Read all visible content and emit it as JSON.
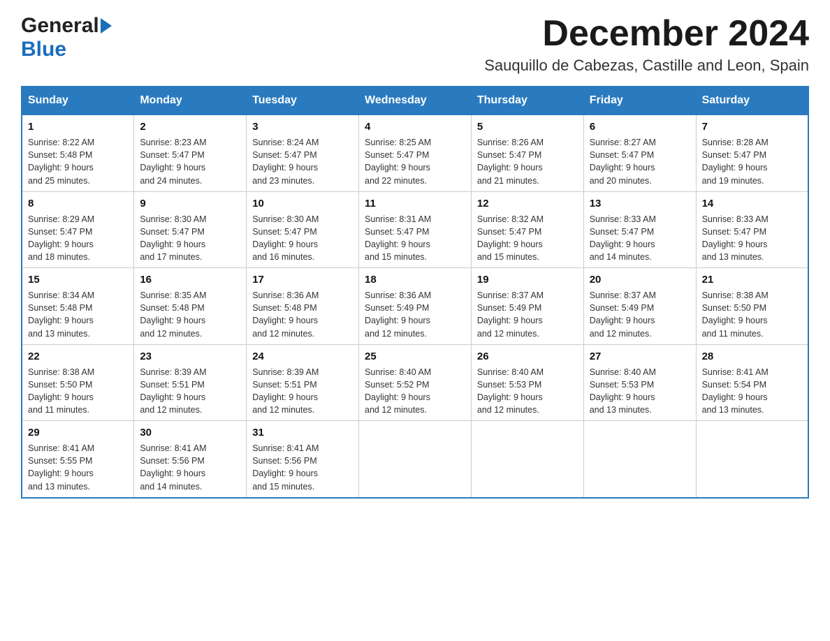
{
  "header": {
    "logo_general": "General",
    "logo_blue": "Blue",
    "month_title": "December 2024",
    "subtitle": "Sauquillo de Cabezas, Castille and Leon, Spain"
  },
  "days_of_week": [
    "Sunday",
    "Monday",
    "Tuesday",
    "Wednesday",
    "Thursday",
    "Friday",
    "Saturday"
  ],
  "weeks": [
    [
      {
        "day": "1",
        "sunrise": "8:22 AM",
        "sunset": "5:48 PM",
        "daylight": "9 hours and 25 minutes."
      },
      {
        "day": "2",
        "sunrise": "8:23 AM",
        "sunset": "5:47 PM",
        "daylight": "9 hours and 24 minutes."
      },
      {
        "day": "3",
        "sunrise": "8:24 AM",
        "sunset": "5:47 PM",
        "daylight": "9 hours and 23 minutes."
      },
      {
        "day": "4",
        "sunrise": "8:25 AM",
        "sunset": "5:47 PM",
        "daylight": "9 hours and 22 minutes."
      },
      {
        "day": "5",
        "sunrise": "8:26 AM",
        "sunset": "5:47 PM",
        "daylight": "9 hours and 21 minutes."
      },
      {
        "day": "6",
        "sunrise": "8:27 AM",
        "sunset": "5:47 PM",
        "daylight": "9 hours and 20 minutes."
      },
      {
        "day": "7",
        "sunrise": "8:28 AM",
        "sunset": "5:47 PM",
        "daylight": "9 hours and 19 minutes."
      }
    ],
    [
      {
        "day": "8",
        "sunrise": "8:29 AM",
        "sunset": "5:47 PM",
        "daylight": "9 hours and 18 minutes."
      },
      {
        "day": "9",
        "sunrise": "8:30 AM",
        "sunset": "5:47 PM",
        "daylight": "9 hours and 17 minutes."
      },
      {
        "day": "10",
        "sunrise": "8:30 AM",
        "sunset": "5:47 PM",
        "daylight": "9 hours and 16 minutes."
      },
      {
        "day": "11",
        "sunrise": "8:31 AM",
        "sunset": "5:47 PM",
        "daylight": "9 hours and 15 minutes."
      },
      {
        "day": "12",
        "sunrise": "8:32 AM",
        "sunset": "5:47 PM",
        "daylight": "9 hours and 15 minutes."
      },
      {
        "day": "13",
        "sunrise": "8:33 AM",
        "sunset": "5:47 PM",
        "daylight": "9 hours and 14 minutes."
      },
      {
        "day": "14",
        "sunrise": "8:33 AM",
        "sunset": "5:47 PM",
        "daylight": "9 hours and 13 minutes."
      }
    ],
    [
      {
        "day": "15",
        "sunrise": "8:34 AM",
        "sunset": "5:48 PM",
        "daylight": "9 hours and 13 minutes."
      },
      {
        "day": "16",
        "sunrise": "8:35 AM",
        "sunset": "5:48 PM",
        "daylight": "9 hours and 12 minutes."
      },
      {
        "day": "17",
        "sunrise": "8:36 AM",
        "sunset": "5:48 PM",
        "daylight": "9 hours and 12 minutes."
      },
      {
        "day": "18",
        "sunrise": "8:36 AM",
        "sunset": "5:49 PM",
        "daylight": "9 hours and 12 minutes."
      },
      {
        "day": "19",
        "sunrise": "8:37 AM",
        "sunset": "5:49 PM",
        "daylight": "9 hours and 12 minutes."
      },
      {
        "day": "20",
        "sunrise": "8:37 AM",
        "sunset": "5:49 PM",
        "daylight": "9 hours and 12 minutes."
      },
      {
        "day": "21",
        "sunrise": "8:38 AM",
        "sunset": "5:50 PM",
        "daylight": "9 hours and 11 minutes."
      }
    ],
    [
      {
        "day": "22",
        "sunrise": "8:38 AM",
        "sunset": "5:50 PM",
        "daylight": "9 hours and 11 minutes."
      },
      {
        "day": "23",
        "sunrise": "8:39 AM",
        "sunset": "5:51 PM",
        "daylight": "9 hours and 12 minutes."
      },
      {
        "day": "24",
        "sunrise": "8:39 AM",
        "sunset": "5:51 PM",
        "daylight": "9 hours and 12 minutes."
      },
      {
        "day": "25",
        "sunrise": "8:40 AM",
        "sunset": "5:52 PM",
        "daylight": "9 hours and 12 minutes."
      },
      {
        "day": "26",
        "sunrise": "8:40 AM",
        "sunset": "5:53 PM",
        "daylight": "9 hours and 12 minutes."
      },
      {
        "day": "27",
        "sunrise": "8:40 AM",
        "sunset": "5:53 PM",
        "daylight": "9 hours and 13 minutes."
      },
      {
        "day": "28",
        "sunrise": "8:41 AM",
        "sunset": "5:54 PM",
        "daylight": "9 hours and 13 minutes."
      }
    ],
    [
      {
        "day": "29",
        "sunrise": "8:41 AM",
        "sunset": "5:55 PM",
        "daylight": "9 hours and 13 minutes."
      },
      {
        "day": "30",
        "sunrise": "8:41 AM",
        "sunset": "5:56 PM",
        "daylight": "9 hours and 14 minutes."
      },
      {
        "day": "31",
        "sunrise": "8:41 AM",
        "sunset": "5:56 PM",
        "daylight": "9 hours and 15 minutes."
      },
      {
        "day": "",
        "sunrise": "",
        "sunset": "",
        "daylight": ""
      },
      {
        "day": "",
        "sunrise": "",
        "sunset": "",
        "daylight": ""
      },
      {
        "day": "",
        "sunrise": "",
        "sunset": "",
        "daylight": ""
      },
      {
        "day": "",
        "sunrise": "",
        "sunset": "",
        "daylight": ""
      }
    ]
  ],
  "labels": {
    "sunrise": "Sunrise:",
    "sunset": "Sunset:",
    "daylight": "Daylight:"
  },
  "colors": {
    "header_bg": "#2a7abf",
    "accent": "#1a6ebd"
  }
}
